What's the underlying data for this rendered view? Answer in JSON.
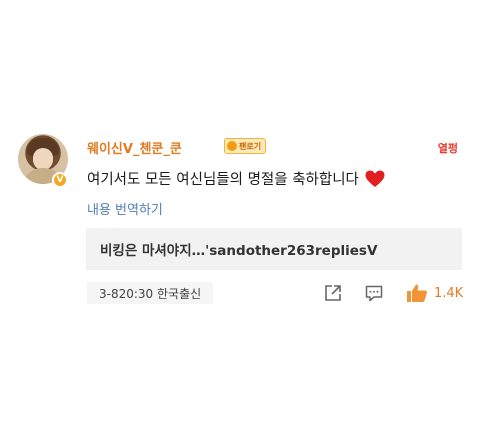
{
  "comment": {
    "username": "웨이신V_첸쿤_쿤",
    "medal": {
      "icon": "medal-icon",
      "label": "팬로기"
    },
    "rank_tag": "열펑",
    "text": "여기서도 모든 여신님들의 명절을 축하합니다",
    "emoji": "heart-emoji",
    "translate_label": "내용 번역하기",
    "reply_preview": "비킹은 마셔야지…'sandother263repliesV",
    "meta": "3-820:30 한국출신",
    "like_count": "1.4K"
  },
  "colors": {
    "username": "#e07b1f",
    "rank_tag": "#e63b2e",
    "link": "#4f7fb7",
    "like": "#e87a2a",
    "heart": "#e02020"
  },
  "icons": [
    "share-icon",
    "reply-icon",
    "like-icon",
    "verified-v-icon"
  ]
}
